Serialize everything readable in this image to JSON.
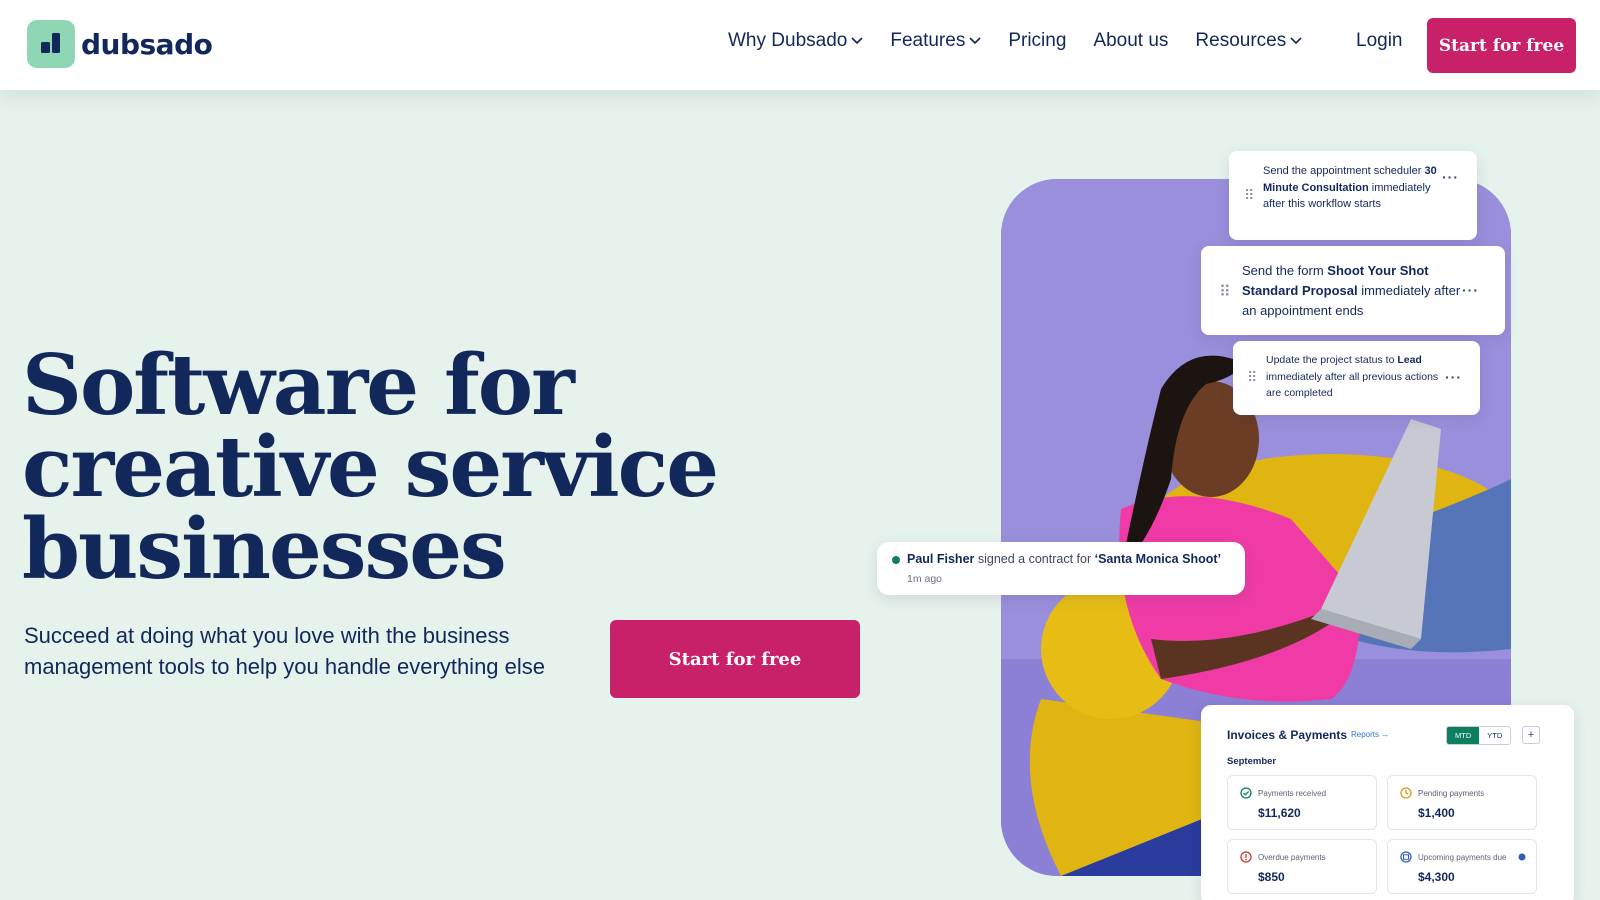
{
  "brand": {
    "name": "dubsado",
    "logo_color": "#8fd7b4",
    "accent": "#c8216a"
  },
  "nav": {
    "items": [
      {
        "label": "Why Dubsado",
        "has_dropdown": true
      },
      {
        "label": "Features",
        "has_dropdown": true
      },
      {
        "label": "Pricing",
        "has_dropdown": false
      },
      {
        "label": "About us",
        "has_dropdown": false
      },
      {
        "label": "Resources",
        "has_dropdown": true
      }
    ],
    "login": "Login",
    "cta": "Start for free"
  },
  "hero": {
    "headline": [
      "Software for",
      "creative service",
      "businesses"
    ],
    "subtext": "Succeed at doing what you love with the business management tools to help you handle everything else",
    "cta": "Start for free"
  },
  "workflow": [
    {
      "pre": "Send the appointment scheduler ",
      "bold": "30 Minute Consultation",
      "post": " immediately after this workflow starts"
    },
    {
      "pre": "Send the form ",
      "bold": "Shoot Your Shot Standard Proposal",
      "post": " immediately after an appointment ends"
    },
    {
      "pre": "Update the project status to ",
      "bold": "Lead",
      "post": " immediately after all previous actions are completed"
    }
  ],
  "notification": {
    "name": "Paul Fisher",
    "action": " signed a contract for ",
    "project": "‘Santa Monica Shoot’",
    "time": "1m ago"
  },
  "invoices": {
    "title": "Invoices & Payments",
    "reports_link": "Reports →",
    "toggle": [
      "MTD",
      "YTD"
    ],
    "add": "+",
    "month": "September",
    "tiles": [
      {
        "label": "Payments received",
        "value": "$11,620",
        "icon": "check-circle-icon",
        "color": "#0d7f5e"
      },
      {
        "label": "Pending payments",
        "value": "$1,400",
        "icon": "clock-icon",
        "color": "#d89a12"
      },
      {
        "label": "Overdue payments",
        "value": "$850",
        "icon": "alert-circle-icon",
        "color": "#d0342c"
      },
      {
        "label": "Upcoming payments due",
        "value": "$4,300",
        "icon": "calendar-icon",
        "color": "#2f5fb3"
      }
    ]
  }
}
